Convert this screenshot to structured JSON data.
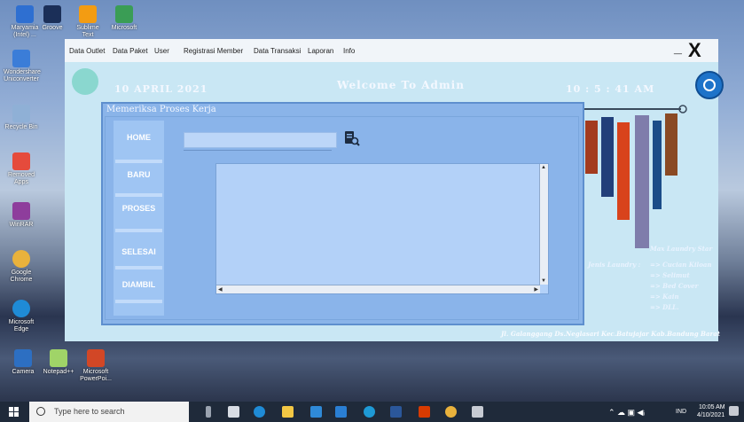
{
  "desktop": {
    "icons": [
      {
        "label": "Maryamia (Intel) ..."
      },
      {
        "label": "Groove"
      },
      {
        "label": "Sublime Text"
      },
      {
        "label": "Microsoft"
      },
      {
        "label": "Wondershare Uniconverter"
      },
      {
        "label": "Recycle Bin"
      },
      {
        "label": "Removed Apps"
      },
      {
        "label": "WinRAR"
      },
      {
        "label": "Google Chrome"
      },
      {
        "label": "Microsoft Edge"
      },
      {
        "label": "Camera"
      },
      {
        "label": "Notepad++"
      },
      {
        "label": "Microsoft PowerPoi..."
      }
    ]
  },
  "menu": {
    "items": [
      "Data Outlet",
      "Data Paket",
      "User",
      "Registrasi Member",
      "Data Transaksi",
      "Laporan",
      "Info"
    ],
    "minimize": "_",
    "close": "X"
  },
  "header": {
    "date": "10 APRIL 2021",
    "welcome": "Welcome To Admin",
    "time": "10 : 5 : 41  AM"
  },
  "dialog": {
    "title": "Memeriksa Proses Kerja",
    "nav": [
      "HOME",
      "BARU",
      "PROSES",
      "SELESAI",
      "DIAMBIL"
    ],
    "search_value": ""
  },
  "side_info": {
    "store": "Max Laundry Star",
    "label": "Jenis Laundry :",
    "items": [
      "=> Cucian Kiloan",
      "=> Selimut",
      "=> Bed Cover",
      "=> Kain",
      "=> DLL."
    ]
  },
  "address": "Jl. Galanggang Ds.Neglasari Kec.Batujajar Kab.Bandung Barat",
  "taskbar": {
    "search_placeholder": "Type here to search",
    "lang": "IND",
    "time": "10:05 AM",
    "date": "4/10/2021"
  }
}
